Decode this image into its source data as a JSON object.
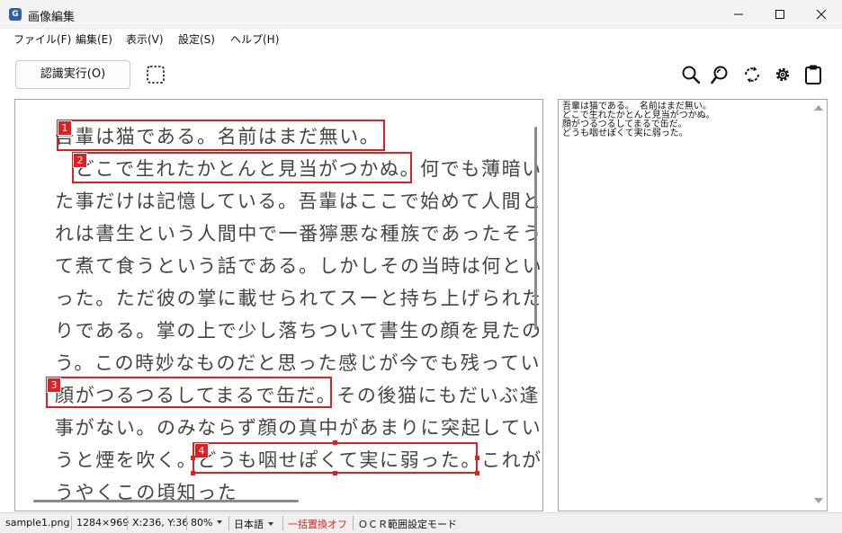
{
  "window": {
    "icon_letter": "G",
    "title": "画像編集"
  },
  "menu": [
    {
      "label": "ファイル(F)"
    },
    {
      "label": "編集(E)"
    },
    {
      "label": "表示(V)"
    },
    {
      "label": "設定(S)"
    },
    {
      "label": "ヘルプ(H)"
    }
  ],
  "toolbar": {
    "run_label": "認識実行(O)",
    "icons": [
      "zoom-in-icon",
      "zoom-out-icon",
      "rotate-icon",
      "gear-icon",
      "clipboard-icon"
    ]
  },
  "document": {
    "lines": [
      "吾輩は猫である。名前はまだ無い。",
      "　どこで生れたかとんと見当がつかぬ。何でも薄暗い",
      "た事だけは記憶している。吾輩はここで始めて人間と",
      "れは書生という人間中で一番獰悪な種族であったそう",
      "て煮て食うという話である。しかしその当時は何とい",
      "った。ただ彼の掌に載せられてスーと持ち上げられた",
      "りである。掌の上で少し落ちついて書生の顔を見たの",
      "う。この時妙なものだと思った感じが今でも残ってい",
      "顔がつるつるしてまるで缶だ。その後猫にもだいぶ逢",
      "事がない。のみならず顔の真中があまりに突起してい",
      "うと煙を吹く。どうも咽せぽくて実に弱った。これが",
      "うやくこの頃知った"
    ],
    "regions": [
      {
        "number": "1"
      },
      {
        "number": "2"
      },
      {
        "number": "3"
      },
      {
        "number": "4"
      }
    ]
  },
  "ocr_text": [
    "吾輩は猫である。 名前はまだ無い。",
    "どこで生れたかとんと見当がつかぬ。",
    "顔がつるつるしてまるで缶だ。",
    "どうも咽せぽくて実に弱った。"
  ],
  "status": {
    "filename": "sample1.png",
    "dimensions": "1284×969",
    "cursor": "X:236, Y:36",
    "zoom": "80%",
    "language": "日本語",
    "replace_mode": "一括置換オフ",
    "mode": "ＯＣＲ範囲設定モード"
  },
  "colors": {
    "region_border": "#e02020",
    "replace_mode_text": "#e02020",
    "app_icon": "#2f5fa8"
  }
}
